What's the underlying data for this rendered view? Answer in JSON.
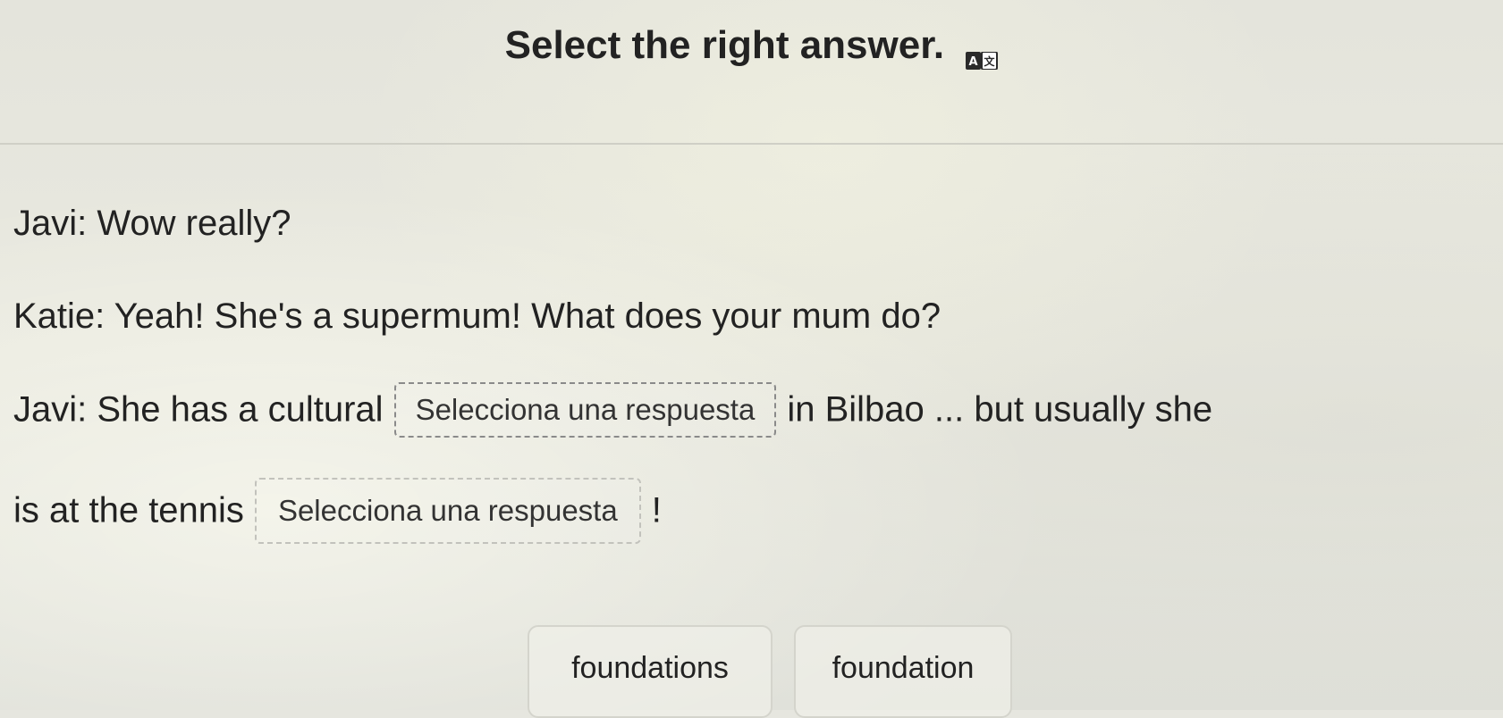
{
  "header": {
    "title": "Select the right answer.",
    "translate_icon": "translate-icon"
  },
  "dialogue": {
    "line1": "Javi: Wow really?",
    "line2": "Katie: Yeah! She's a supermum! What does your mum do?",
    "line3_before": "Javi: She has a cultural",
    "line3_after": "in Bilbao ... but usually she",
    "line4_before": "is at the tennis",
    "line4_after": "!"
  },
  "dropdowns": [
    {
      "placeholder": "Selecciona una respuesta"
    },
    {
      "placeholder": "Selecciona una respuesta"
    }
  ],
  "options": [
    {
      "label": "foundations"
    },
    {
      "label": "foundation"
    }
  ]
}
